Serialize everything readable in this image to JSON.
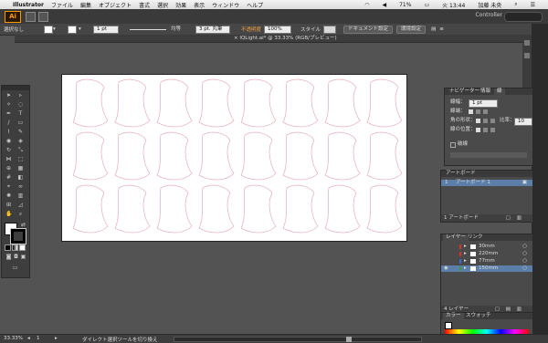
{
  "menubar": {
    "apple": "",
    "app": "Illustrator",
    "menus": [
      "ファイル",
      "編集",
      "オブジェクト",
      "書式",
      "選択",
      "効果",
      "表示",
      "ウィンドウ",
      "ヘルプ"
    ],
    "status": {
      "battery": "71%",
      "time": "火 13:44",
      "user": "加藤 未央"
    }
  },
  "appbar": {
    "logo": "Ai",
    "controller": "Controller"
  },
  "ctrlbar": {
    "selection": "選択なし",
    "stroke_weight": "1 pt",
    "stroke_style": "均等",
    "brush": "3 pt. 丸筆",
    "opacity_label": "不透明度",
    "opacity_value": "100%",
    "style_label": "スタイル",
    "doc_setup": "ドキュメント設定",
    "prefs": "環境設定"
  },
  "document": {
    "tab_title": "IQLight.ai* @ 33.33% (RGB/プレビュー)"
  },
  "stroke_panel": {
    "tabs": [
      "ナビゲーター",
      "情報",
      "線"
    ],
    "weight_label": "線幅：",
    "weight_value": "1 pt",
    "cap_label": "線端：",
    "corner_label": "角の形状：",
    "limit_label": "比率：",
    "limit_value": "10",
    "align_label": "線の位置：",
    "dashed_label": "破線"
  },
  "artboard_panel": {
    "title": "アートボード",
    "items": [
      {
        "index": "1",
        "name": "アートボード 1"
      }
    ],
    "footer": "1 アートボード"
  },
  "layers_panel": {
    "tabs": [
      "レイヤー",
      "リンク"
    ],
    "layers": [
      {
        "name": "30mm",
        "color": "#d9342b"
      },
      {
        "name": "220mm",
        "color": "#d9342b"
      },
      {
        "name": "77mm",
        "color": "#3c6ad9"
      },
      {
        "name": "150mm",
        "color": "#3c9a3c"
      }
    ],
    "footer": "4 レイヤー"
  },
  "color_panel": {
    "tabs": [
      "カラー",
      "スウォッチ"
    ]
  },
  "status": {
    "zoom": "33.33%",
    "page": "1",
    "tool_hint": "ダイレクト選択ツールを切り換え"
  }
}
